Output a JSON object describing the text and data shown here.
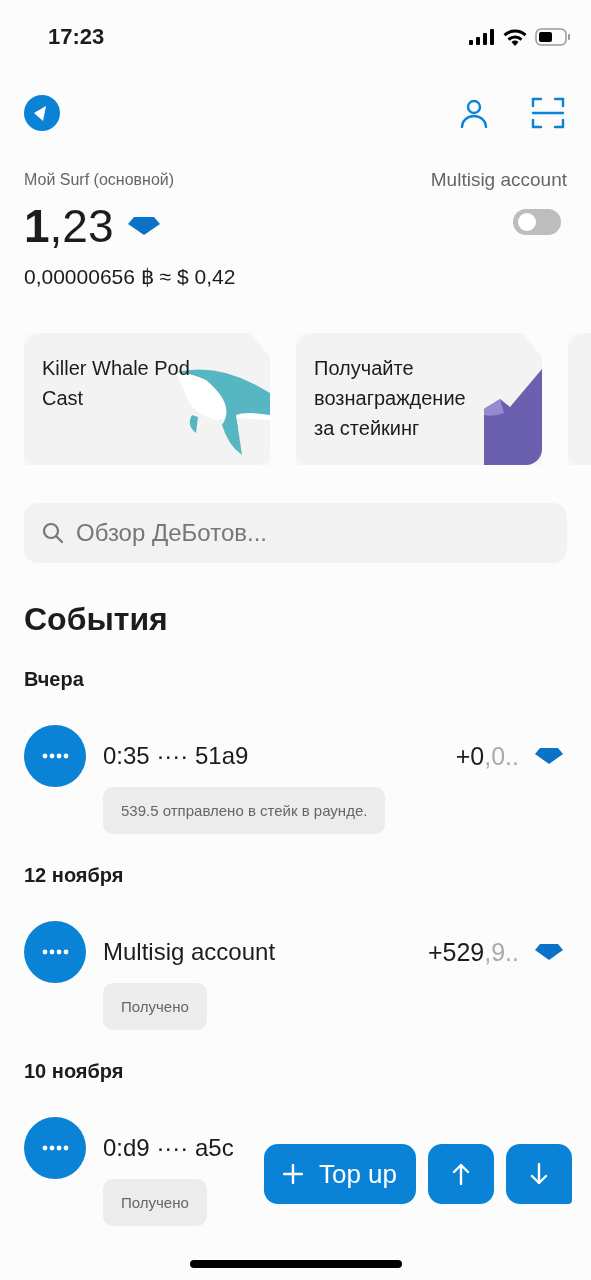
{
  "status_bar": {
    "time": "17:23"
  },
  "account": {
    "name": "Мой Surf (основной)",
    "balance": "**1**,23",
    "fiat": "0,00000656 ฿ ≈ $ 0,42"
  },
  "multisig": {
    "label": "Multisig account",
    "on": false
  },
  "cards": [
    {
      "kind": "whale",
      "title": "Killer Whale Pod Cast"
    },
    {
      "kind": "stake",
      "title": "Получайте вознаграждение за стейкинг"
    },
    {
      "kind": "partial"
    }
  ],
  "search": {
    "placeholder": "Обзор ДеБотов..."
  },
  "events_title": "События",
  "groups": [
    {
      "date": "Вчера",
      "events": [
        {
          "title": "0:35 ···· 51a9",
          "amount_int": "+0",
          "amount_frac": ",0..",
          "note": "539.5 отправлено в стейк в раунде."
        }
      ]
    },
    {
      "date": "12 ноября",
      "events": [
        {
          "title": "Multisig account",
          "amount_int": "+529",
          "amount_frac": ",9..",
          "note": "Получено"
        }
      ]
    },
    {
      "date": "10 ноября",
      "events": [
        {
          "title": "0:d9 ···· a5c",
          "note": "Получено"
        }
      ]
    }
  ],
  "actions": [
    {
      "kind": "topup",
      "label": "Top up"
    },
    {
      "kind": "send"
    },
    {
      "kind": "receive"
    }
  ]
}
